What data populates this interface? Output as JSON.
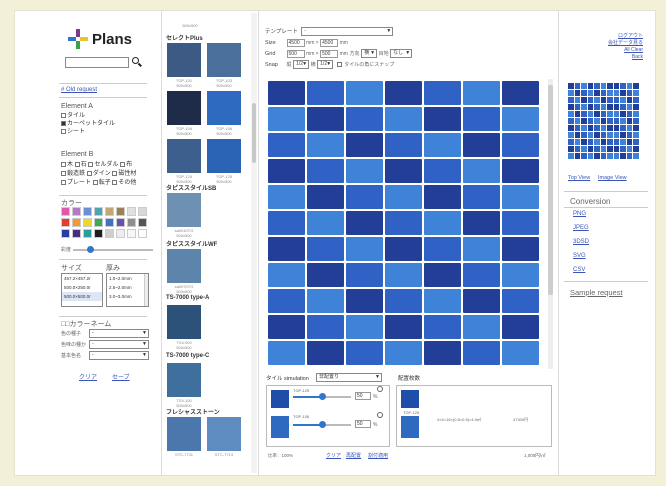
{
  "brand": {
    "name": "Plans",
    "colors": {
      "blue": "#2e77c9",
      "purple": "#7a3d8a",
      "green": "#3aa14a",
      "yellow": "#e7c52b"
    }
  },
  "left": {
    "search_placeholder": "",
    "old_request": "# Old request",
    "element_a": {
      "title": "Element A",
      "items": [
        {
          "label": "タイル",
          "checked": false
        },
        {
          "label": "カーペットタイル",
          "checked": true
        },
        {
          "label": "シート",
          "checked": false
        }
      ]
    },
    "element_b": {
      "title": "Element B",
      "items": [
        "木",
        "石",
        "セルダル",
        "布",
        "鍛造鉄",
        "ダイン",
        "磁性材",
        "プレート",
        "転子",
        "その他"
      ]
    },
    "color_title": "カラー",
    "swatches": [
      "#e25aa5",
      "#b678c5",
      "#6b8fd2",
      "#4da6ad",
      "#c2a874",
      "#9c7e57",
      "#e0e0e0",
      "#d8d8d8",
      "#e83a30",
      "#f29a2f",
      "#e9d92d",
      "#3daa55",
      "#3f71c8",
      "#6a4fb4",
      "#8f8f8f",
      "#555555",
      "#2a3da2",
      "#4b2c7f",
      "#2f9a9a",
      "#1e1e1e",
      "#cfcfcf",
      "#ededed",
      "#f7f7f7",
      "#ffffff"
    ],
    "slider_label": "彩度",
    "size": {
      "title": "サイズ",
      "items": [
        "457.2×457.2r",
        "500.0×250.0r",
        "500.0×500.0r"
      ]
    },
    "thickness": {
      "title": "厚み",
      "items": [
        "1.0~2.0mm",
        "2.5~2.0mm",
        "3.0~3.0mm"
      ]
    },
    "name_section": {
      "title": "□□カラーネーム",
      "rows": [
        {
          "label": "色の種子",
          "value": "-"
        },
        {
          "label": "色味の種か",
          "value": "-"
        },
        {
          "label": "基本色名",
          "value": "-"
        }
      ]
    },
    "clear": "クリア",
    "save": "セーブ"
  },
  "products": {
    "top_caption": "500x500",
    "groups": [
      {
        "name": "セレクトPlus",
        "thumbs": [
          {
            "color": "#3d5a84",
            "caption": "TGP-101\n500x500"
          },
          {
            "color": "#4a6f9a",
            "caption": "TGP-103\n500x500"
          },
          {
            "color": "#1e2c4a",
            "caption": "TGP-104\n500x500"
          },
          {
            "color": "#2e6bc0",
            "caption": "TGP-106\n500x500"
          },
          {
            "color": "#3c5f8e",
            "caption": "TGP-124\n500x500"
          },
          {
            "color": "#2b63b5",
            "caption": "TGP-125\n500x500"
          }
        ]
      },
      {
        "name": "タピススタイルSB",
        "thumbs": [
          {
            "color": "#6d90b3",
            "caption": "sa0010TG\n500x500"
          }
        ]
      },
      {
        "name": "タピススタイルWF",
        "thumbs": [
          {
            "color": "#5d85ab",
            "caption": "sa0070TG\n500x500"
          }
        ]
      },
      {
        "name": "TS-7000 type-A",
        "thumbs": [
          {
            "color": "#2d527a",
            "caption": "TS4-900\n500x500"
          }
        ]
      },
      {
        "name": "TS-7000 type-C",
        "thumbs": [
          {
            "color": "#3f6f9c",
            "caption": "TS4-100\n500x500"
          }
        ]
      },
      {
        "name": "フレシャスストーン",
        "thumbs": [
          {
            "color": "#4c77ad",
            "caption": "STC-7711"
          },
          {
            "color": "#5e8bc0",
            "caption": "STC-7713"
          }
        ]
      }
    ]
  },
  "editor": {
    "template_label": "テンプレート",
    "template_value": "-",
    "size_label": "Size",
    "size_w": "4500",
    "size_h": "4500",
    "mm": "mm",
    "grid_label": "Grid",
    "grid_w": "500",
    "grid_h": "500",
    "grid_angle_label": "方向",
    "grid_angle": "横",
    "grid_space_label": "目地",
    "grid_space": "なし",
    "snap_label": "Snap",
    "snap_x_label": "縦",
    "snap_x": "1/2",
    "snap_y_label": "横",
    "snap_y": "1/2",
    "snap_check": "タイルの角にスナップ",
    "tile_colors": {
      "dark": "#233e97",
      "mid": "#2f62c4",
      "light": "#3f83d8"
    },
    "tile_pattern": [
      "dmldmld",
      "ldmldml",
      "mldmldm",
      "dmldmld",
      "ldmldml",
      "mldmldm",
      "dmldmld",
      "ldmldml",
      "mldmldm",
      "dmldmld",
      "ldmldml"
    ],
    "mix": {
      "title": "タイル simulation",
      "select": "非配置り",
      "rows": [
        {
          "code": "TGP-125",
          "color": "#1e4ea8",
          "value": "50",
          "unit": "%"
        },
        {
          "code": "TGP-106",
          "color": "#2e6bc0",
          "value": "50",
          "unit": "%"
        }
      ],
      "footer": {
        "ratio": "比率：100%",
        "clear": "クリア",
        "auto": "再配置",
        "apply": "割付適用"
      }
    },
    "quantity": {
      "title": "配置枚数",
      "row": {
        "code": "TGP-125",
        "detail": "4×4=16×(0.5×0.5)=4.0㎡",
        "total": "47400円"
      },
      "sum": "1,000円/㎡"
    }
  },
  "right": {
    "links": [
      "ログアウト",
      "会社データ見る",
      "All Clear",
      "Back"
    ],
    "view_links": [
      "Top View",
      "Image View"
    ],
    "conversion_title": "Conversion",
    "conversion": [
      "PNG",
      "JPEG",
      "3DSD",
      "SVG",
      "CSV"
    ],
    "sample": "Sample request"
  }
}
